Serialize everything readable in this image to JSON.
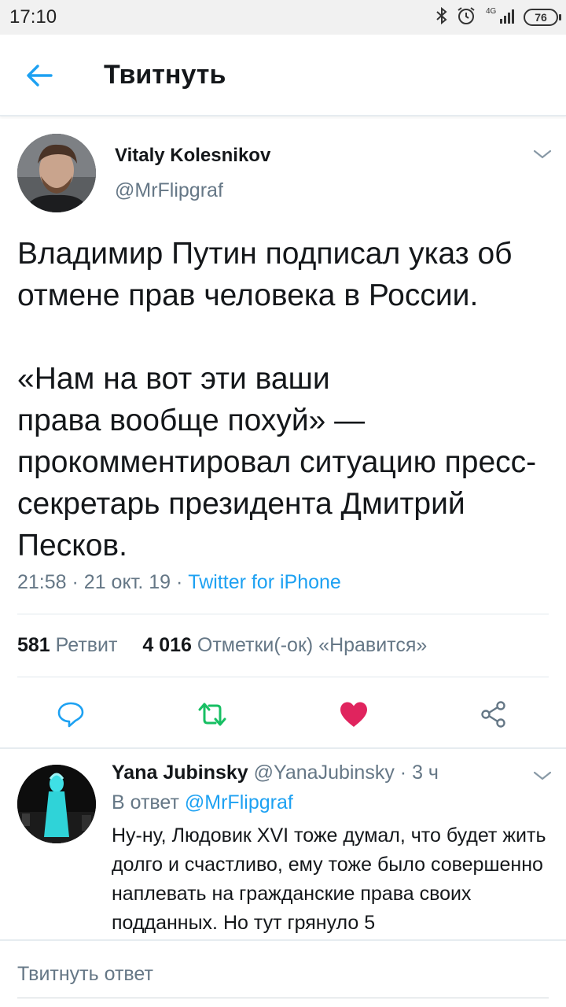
{
  "status_bar": {
    "time": "17:10",
    "network": "4G",
    "battery": "76",
    "icons": [
      "bluetooth-icon",
      "alarm-icon",
      "signal-icon",
      "battery-icon"
    ]
  },
  "app_bar": {
    "title": "Твитнуть",
    "back_icon": "arrow-left-icon"
  },
  "tweet": {
    "author_name": "Vitaly Kolesnikov",
    "author_handle": "@MrFlipgraf",
    "text": "Владимир Путин подписал указ об отмене прав человека в России.\n\n«Нам на вот эти ваши\nправа вообще похуй» —\nпрокомментировал ситуацию пресс-секретарь президента Дмитрий Песков.",
    "time": "21:58",
    "date": "21 окт. 19",
    "source": "Twitter for iPhone",
    "retweets_count": "581",
    "retweets_label": "Ретвит",
    "likes_count": "4 016",
    "likes_label": "Отметки(-ок) «Нравится»"
  },
  "actions": {
    "reply_icon": "reply-icon",
    "retweet_icon": "retweet-icon",
    "like_icon": "heart-icon",
    "share_icon": "share-icon"
  },
  "reply": {
    "author_name": "Yana Jubinsky",
    "author_handle": "@YanaJubinsky",
    "time": "3 ч",
    "reply_to_label": "В ответ",
    "reply_to_handle": "@MrFlipgraf",
    "text": "Ну-ну, Людовик XVI тоже думал, что будет жить долго и счастливо, ему тоже было совершенно наплевать на гражданские права своих подданных. Но тут грянуло 5"
  },
  "compose": {
    "placeholder": "Твитнуть ответ"
  },
  "colors": {
    "accent": "#1da1f2",
    "retweet": "#17bf63",
    "like": "#e0245e",
    "secondary_text": "#657786",
    "primary_text": "#14171a"
  }
}
